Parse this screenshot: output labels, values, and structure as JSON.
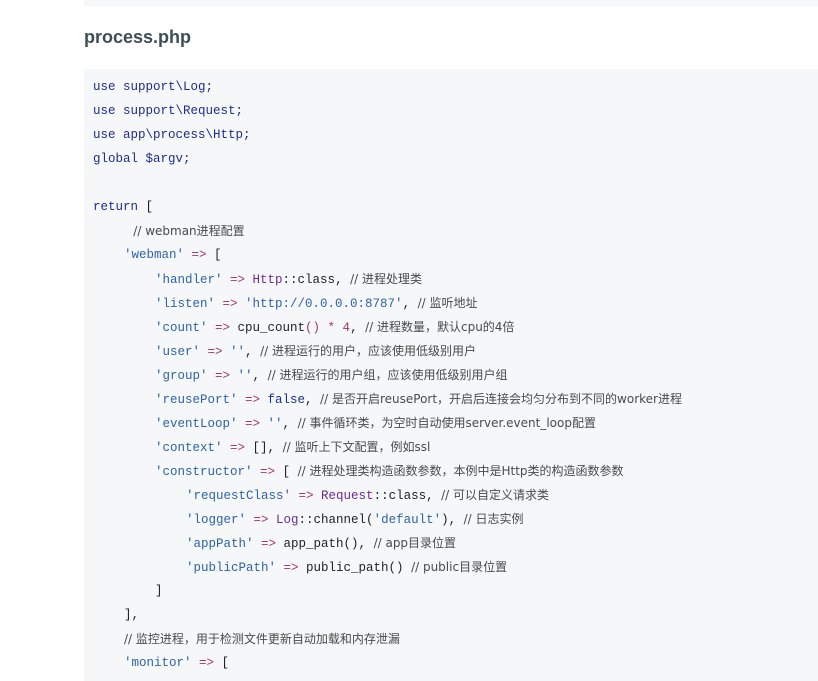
{
  "page": {
    "title": "process.php"
  },
  "code": {
    "lines": [
      {
        "indent": 0,
        "segments": [
          {
            "t": "use support\\Log;",
            "c": "kw"
          }
        ]
      },
      {
        "indent": 0,
        "segments": [
          {
            "t": "use support\\Request;",
            "c": "kw"
          }
        ]
      },
      {
        "indent": 0,
        "segments": [
          {
            "t": "use app\\process\\Http;",
            "c": "kw"
          }
        ]
      },
      {
        "indent": 0,
        "segments": [
          {
            "t": "global $argv;",
            "c": "kw"
          }
        ]
      },
      {
        "indent": 0,
        "segments": []
      },
      {
        "indent": 0,
        "segments": [
          {
            "t": "return",
            "c": "kw"
          },
          {
            "t": " [",
            "c": "plain"
          }
        ]
      },
      {
        "indent": 1.3,
        "segments": [
          {
            "t": "// webman进程配置",
            "c": "cm"
          }
        ]
      },
      {
        "indent": 1,
        "segments": [
          {
            "t": "'webman'",
            "c": "str"
          },
          {
            "t": " => ",
            "c": "op"
          },
          {
            "t": "[",
            "c": "plain"
          }
        ]
      },
      {
        "indent": 2,
        "segments": [
          {
            "t": "'handler'",
            "c": "str"
          },
          {
            "t": " => ",
            "c": "op"
          },
          {
            "t": "Http",
            "c": "cls"
          },
          {
            "t": "::class",
            "c": "plain"
          },
          {
            "t": ", ",
            "c": "plain"
          },
          {
            "t": "// 进程处理类",
            "c": "cm"
          }
        ]
      },
      {
        "indent": 2,
        "segments": [
          {
            "t": "'listen'",
            "c": "str"
          },
          {
            "t": " => ",
            "c": "op"
          },
          {
            "t": "'http://0.0.0.0:8787'",
            "c": "str"
          },
          {
            "t": ", ",
            "c": "plain"
          },
          {
            "t": "// 监听地址",
            "c": "cm"
          }
        ]
      },
      {
        "indent": 2,
        "segments": [
          {
            "t": "'count'",
            "c": "str"
          },
          {
            "t": " => ",
            "c": "op"
          },
          {
            "t": "cpu_count",
            "c": "fn"
          },
          {
            "t": "() * 4",
            "c": "op"
          },
          {
            "t": ", ",
            "c": "plain"
          },
          {
            "t": "// 进程数量，默认cpu的4倍",
            "c": "cm"
          }
        ]
      },
      {
        "indent": 2,
        "segments": [
          {
            "t": "'user'",
            "c": "str"
          },
          {
            "t": " => ",
            "c": "op"
          },
          {
            "t": "''",
            "c": "str"
          },
          {
            "t": ", ",
            "c": "plain"
          },
          {
            "t": "// 进程运行的用户，应该使用低级别用户",
            "c": "cm"
          }
        ]
      },
      {
        "indent": 2,
        "segments": [
          {
            "t": "'group'",
            "c": "str"
          },
          {
            "t": " => ",
            "c": "op"
          },
          {
            "t": "''",
            "c": "str"
          },
          {
            "t": ", ",
            "c": "plain"
          },
          {
            "t": "// 进程运行的用户组，应该使用低级别用户组",
            "c": "cm"
          }
        ]
      },
      {
        "indent": 2,
        "segments": [
          {
            "t": "'reusePort'",
            "c": "str"
          },
          {
            "t": " => ",
            "c": "op"
          },
          {
            "t": "false",
            "c": "kw"
          },
          {
            "t": ", ",
            "c": "plain"
          },
          {
            "t": "// 是否开启reusePort，开启后连接会均匀分布到不同的worker进程",
            "c": "cm"
          }
        ]
      },
      {
        "indent": 2,
        "segments": [
          {
            "t": "'eventLoop'",
            "c": "str"
          },
          {
            "t": " => ",
            "c": "op"
          },
          {
            "t": "''",
            "c": "str"
          },
          {
            "t": ", ",
            "c": "plain"
          },
          {
            "t": "// 事件循环类，为空时自动使用server.event_loop配置",
            "c": "cm"
          }
        ]
      },
      {
        "indent": 2,
        "segments": [
          {
            "t": "'context'",
            "c": "str"
          },
          {
            "t": " => ",
            "c": "op"
          },
          {
            "t": "[]",
            "c": "plain"
          },
          {
            "t": ", ",
            "c": "plain"
          },
          {
            "t": "// 监听上下文配置，例如ssl",
            "c": "cm"
          }
        ]
      },
      {
        "indent": 2,
        "segments": [
          {
            "t": "'constructor'",
            "c": "str"
          },
          {
            "t": " => ",
            "c": "op"
          },
          {
            "t": "[ ",
            "c": "plain"
          },
          {
            "t": "// 进程处理类构造函数参数，本例中是Http类的构造函数参数",
            "c": "cm"
          }
        ]
      },
      {
        "indent": 3,
        "segments": [
          {
            "t": "'requestClass'",
            "c": "str"
          },
          {
            "t": " => ",
            "c": "op"
          },
          {
            "t": "Request",
            "c": "cls"
          },
          {
            "t": "::class",
            "c": "plain"
          },
          {
            "t": ", ",
            "c": "plain"
          },
          {
            "t": "// 可以自定义请求类",
            "c": "cm"
          }
        ]
      },
      {
        "indent": 3,
        "segments": [
          {
            "t": "'logger'",
            "c": "str"
          },
          {
            "t": " => ",
            "c": "op"
          },
          {
            "t": "Log",
            "c": "cls"
          },
          {
            "t": "::channel(",
            "c": "plain"
          },
          {
            "t": "'default'",
            "c": "str"
          },
          {
            "t": "), ",
            "c": "plain"
          },
          {
            "t": "// 日志实例",
            "c": "cm"
          }
        ]
      },
      {
        "indent": 3,
        "segments": [
          {
            "t": "'appPath'",
            "c": "str"
          },
          {
            "t": " => ",
            "c": "op"
          },
          {
            "t": "app_path",
            "c": "fn"
          },
          {
            "t": "(), ",
            "c": "plain"
          },
          {
            "t": "// app目录位置",
            "c": "cm"
          }
        ]
      },
      {
        "indent": 3,
        "segments": [
          {
            "t": "'publicPath'",
            "c": "str"
          },
          {
            "t": " => ",
            "c": "op"
          },
          {
            "t": "public_path",
            "c": "fn"
          },
          {
            "t": "() ",
            "c": "plain"
          },
          {
            "t": "// public目录位置",
            "c": "cm"
          }
        ]
      },
      {
        "indent": 2,
        "segments": [
          {
            "t": "]",
            "c": "plain"
          }
        ]
      },
      {
        "indent": 1,
        "segments": [
          {
            "t": "],",
            "c": "plain"
          }
        ]
      },
      {
        "indent": 1,
        "segments": [
          {
            "t": "// 监控进程，用于检测文件更新自动加载和内存泄漏",
            "c": "cm"
          }
        ]
      },
      {
        "indent": 1,
        "segments": [
          {
            "t": "'monitor'",
            "c": "str"
          },
          {
            "t": " => ",
            "c": "op"
          },
          {
            "t": "[",
            "c": "plain"
          }
        ]
      }
    ]
  }
}
